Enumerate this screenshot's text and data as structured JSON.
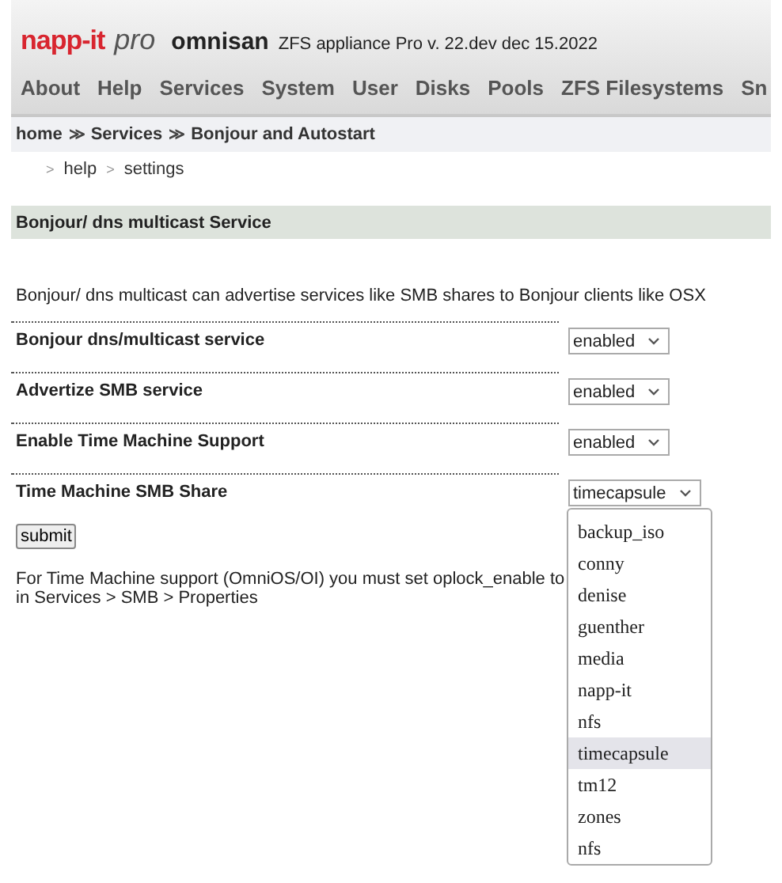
{
  "header": {
    "logo": "napp-it",
    "edition": "pro",
    "host": "omnisan",
    "version": "ZFS appliance Pro v. 22.dev dec 15.2022"
  },
  "nav": [
    {
      "label": "About"
    },
    {
      "label": "Help"
    },
    {
      "label": "Services"
    },
    {
      "label": "System"
    },
    {
      "label": "User"
    },
    {
      "label": "Disks"
    },
    {
      "label": "Pools"
    },
    {
      "label": "ZFS Filesystems"
    },
    {
      "label": "Sn"
    }
  ],
  "breadcrumb": [
    {
      "label": "home"
    },
    {
      "label": "Services"
    },
    {
      "label": "Bonjour and Autostart"
    }
  ],
  "breadcrumb_separator": "≫",
  "sublinks": [
    {
      "label": "help"
    },
    {
      "label": "settings"
    }
  ],
  "sublink_separator": ">",
  "section_title": "Bonjour/ dns multicast Service",
  "description": "Bonjour/ dns multicast can advertise services like SMB shares to Bonjour clients like OSX",
  "settings": [
    {
      "label": "Bonjour dns/multicast service",
      "value": "enabled"
    },
    {
      "label": "Advertize SMB service",
      "value": "enabled"
    },
    {
      "label": "Enable Time Machine Support",
      "value": "enabled"
    },
    {
      "label": "Time Machine SMB Share",
      "value": "timecapsule",
      "open": true
    }
  ],
  "submit": "submit",
  "note": [
    "For Time Machine support (OmniOS/OI) you must set oplock_enable to",
    "in Services > SMB > Properties"
  ],
  "dropdown_options": [
    {
      "label": "backup_iso",
      "selected": false
    },
    {
      "label": "conny",
      "selected": false
    },
    {
      "label": "denise",
      "selected": false
    },
    {
      "label": "guenther",
      "selected": false
    },
    {
      "label": "media",
      "selected": false
    },
    {
      "label": "napp-it",
      "selected": false
    },
    {
      "label": "nfs",
      "selected": false
    },
    {
      "label": "timecapsule",
      "selected": true
    },
    {
      "label": "tm12",
      "selected": false
    },
    {
      "label": "zones",
      "selected": false
    },
    {
      "label": "nfs",
      "selected": false
    }
  ]
}
